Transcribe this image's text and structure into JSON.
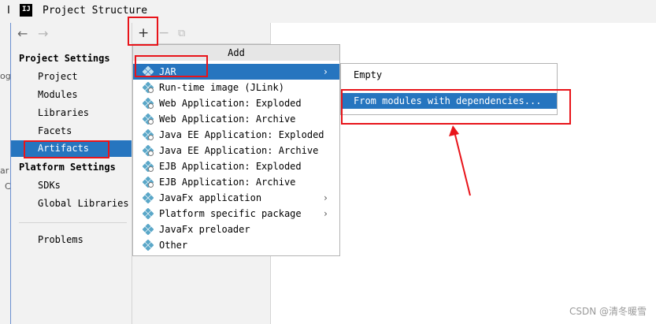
{
  "window": {
    "title": "Project Structure",
    "left_edge_char": "I"
  },
  "background_fragments": [
    "ogr",
    "ar",
    "C"
  ],
  "left_panel": {
    "sections": [
      {
        "heading": "Project Settings",
        "items": [
          "Project",
          "Modules",
          "Libraries",
          "Facets",
          "Artifacts"
        ]
      },
      {
        "heading": "Platform Settings",
        "items": [
          "SDKs",
          "Global Libraries"
        ]
      }
    ],
    "extra_items": [
      "Problems"
    ],
    "selected_item": "Artifacts"
  },
  "toolbar": {
    "back": "←",
    "forward": "→",
    "add": "+",
    "remove": "−",
    "copy": "⧉"
  },
  "popup": {
    "header": "Add",
    "items": [
      {
        "label": "JAR",
        "icon": "diamond-icon",
        "submenu": true,
        "selected": true
      },
      {
        "label": "Run-time image (JLink)",
        "icon": "diamond-gear-icon",
        "submenu": false
      },
      {
        "label": "Web Application: Exploded",
        "icon": "diamond-globe-icon",
        "submenu": false
      },
      {
        "label": "Web Application: Archive",
        "icon": "diamond-globe-icon",
        "submenu": false
      },
      {
        "label": "Java EE Application: Exploded",
        "icon": "diamond-ee-icon",
        "submenu": false
      },
      {
        "label": "Java EE Application: Archive",
        "icon": "diamond-ee-icon",
        "submenu": false
      },
      {
        "label": "EJB Application: Exploded",
        "icon": "diamond-bean-icon",
        "submenu": false
      },
      {
        "label": "EJB Application: Archive",
        "icon": "diamond-bean-icon",
        "submenu": false
      },
      {
        "label": "JavaFx application",
        "icon": "diamond-icon",
        "submenu": true
      },
      {
        "label": "Platform specific package",
        "icon": "diamond-icon",
        "submenu": true
      },
      {
        "label": "JavaFx preloader",
        "icon": "diamond-icon",
        "submenu": false
      },
      {
        "label": "Other",
        "icon": "diamond-icon",
        "submenu": false
      }
    ],
    "submenu_arrow": "›"
  },
  "submenu": {
    "items": [
      "Empty",
      "From modules with dependencies..."
    ],
    "selected_index": 1
  },
  "colors": {
    "selection": "#2675bf",
    "annotation": "#e8141a",
    "icon_diamond": "#5aa7c8"
  },
  "watermark": "CSDN @清冬暖雪"
}
